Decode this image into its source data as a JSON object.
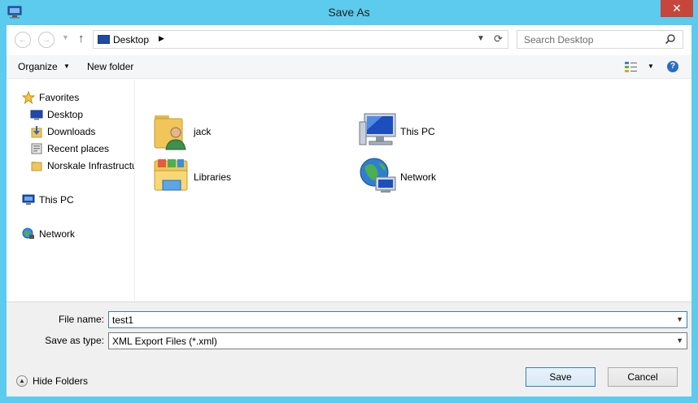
{
  "window": {
    "title": "Save As",
    "close_glyph": "✕"
  },
  "address_bar": {
    "path": "Desktop",
    "back_glyph": "←",
    "forward_glyph": "→",
    "up_glyph": "↑",
    "refresh_glyph": "⟳"
  },
  "search": {
    "placeholder": "Search Desktop"
  },
  "toolbar": {
    "organize_label": "Organize",
    "new_folder_label": "New folder",
    "help_glyph": "?"
  },
  "nav": {
    "favorites_label": "Favorites",
    "items": [
      {
        "label": "Desktop",
        "icon": "desktop-icon"
      },
      {
        "label": "Downloads",
        "icon": "downloads-icon"
      },
      {
        "label": "Recent places",
        "icon": "recent-places-icon"
      },
      {
        "label": "Norskale Infrastructu",
        "icon": "folder-icon"
      }
    ],
    "this_pc_label": "This PC",
    "network_label": "Network"
  },
  "content": {
    "items": [
      {
        "label": "jack",
        "icon": "user-folder-icon"
      },
      {
        "label": "This PC",
        "icon": "computer-icon"
      },
      {
        "label": "Libraries",
        "icon": "libraries-icon"
      },
      {
        "label": "Network",
        "icon": "network-globe-icon"
      }
    ]
  },
  "form": {
    "file_name_label": "File name:",
    "file_name_value": "test1",
    "save_type_label": "Save as type:",
    "save_type_value": "XML Export Files (*.xml)"
  },
  "footer": {
    "hide_folders_label": "Hide Folders",
    "save_label": "Save",
    "cancel_label": "Cancel"
  },
  "colors": {
    "frame": "#5ccbed",
    "close_button": "#c7463c",
    "accent_blue": "#3c7fb1"
  }
}
